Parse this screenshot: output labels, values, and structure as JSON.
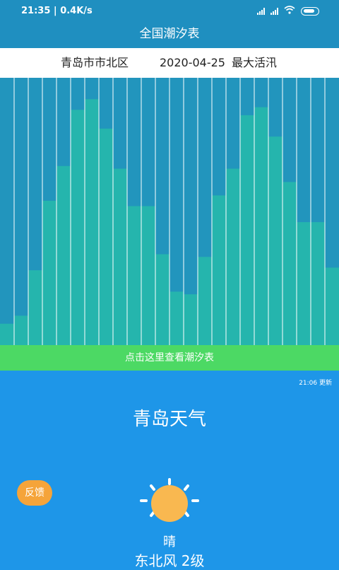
{
  "status_bar": {
    "time": "21:35",
    "speed": "0.4K/s"
  },
  "header": {
    "title": "全国潮汐表"
  },
  "info": {
    "location": "青岛市市北区",
    "date": "2020-04-25",
    "tide_type": "最大活汛"
  },
  "chart_data": {
    "type": "bar",
    "values": [
      0.08,
      0.11,
      0.28,
      0.54,
      0.67,
      0.88,
      0.92,
      0.81,
      0.66,
      0.52,
      0.52,
      0.34,
      0.2,
      0.19,
      0.33,
      0.56,
      0.66,
      0.86,
      0.89,
      0.78,
      0.61,
      0.46,
      0.46,
      0.29
    ],
    "ylim": [
      0,
      1
    ],
    "colors": {
      "background": "#2295bd",
      "bar": "#25b5ad",
      "grid": "#ffffff"
    }
  },
  "view_button": {
    "label": "点击这里查看潮汐表"
  },
  "weather": {
    "update_time": "21:06 更新",
    "city_title": "青岛天气",
    "condition": "晴",
    "wind": "东北风 2级",
    "feedback_label": "反馈"
  },
  "colors": {
    "header": "#1f8fc0",
    "green": "#4cd964",
    "weather_bg": "#1e96e8",
    "feedback": "#f5a43a",
    "sun": "#f9b850"
  }
}
